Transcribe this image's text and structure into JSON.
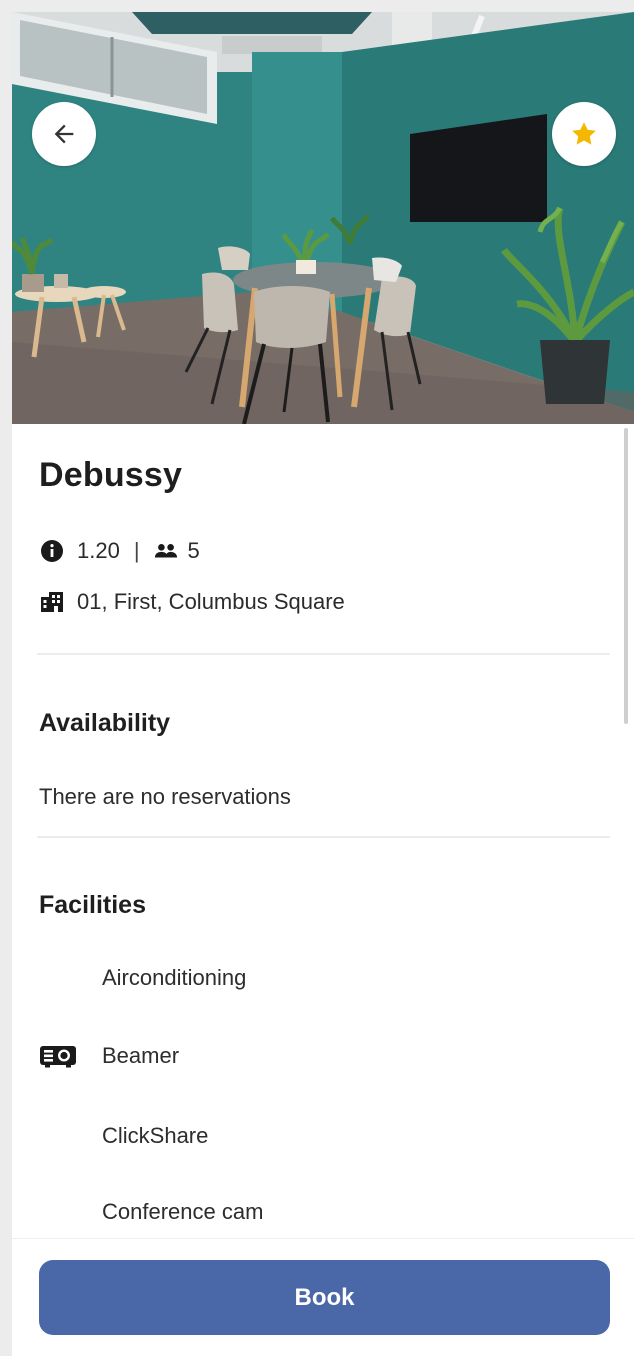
{
  "room": {
    "name": "Debussy",
    "code": "1.20",
    "separator": "|",
    "capacity": "5",
    "location": "01, First, Columbus Square"
  },
  "availability": {
    "title": "Availability",
    "text": "There are no reservations"
  },
  "facilities": {
    "title": "Facilities",
    "items": [
      {
        "label": "Airconditioning",
        "icon": ""
      },
      {
        "label": "Beamer",
        "icon": "projector-icon"
      },
      {
        "label": "ClickShare",
        "icon": ""
      },
      {
        "label": "Conference cam",
        "icon": ""
      }
    ]
  },
  "actions": {
    "book_label": "Book",
    "back_icon": "arrow-left-icon",
    "favorite_icon": "star-icon"
  },
  "colors": {
    "primary": "#4a67a8",
    "favorite": "#f5b800",
    "wall": "#2f8482"
  }
}
